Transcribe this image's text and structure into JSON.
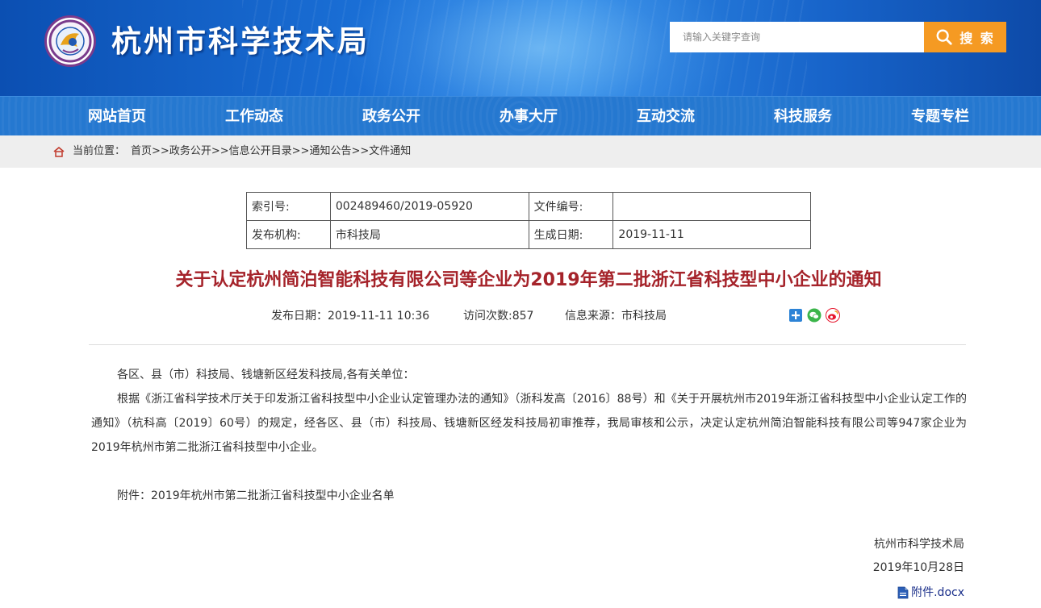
{
  "header": {
    "site_title": "杭州市科学技术局",
    "search_placeholder": "请输入关键字查询",
    "search_button": "搜 索"
  },
  "nav": {
    "items": [
      "网站首页",
      "工作动态",
      "政务公开",
      "办事大厅",
      "互动交流",
      "科技服务",
      "专题专栏"
    ]
  },
  "breadcrumb": {
    "prefix": "当前位置：",
    "links": [
      "首页",
      "政务公开",
      "信息公开目录",
      "通知公告",
      "文件通知"
    ],
    "separator": ">>"
  },
  "meta": {
    "index_label": "索引号:",
    "index_value": "002489460/2019-05920",
    "docno_label": "文件编号:",
    "docno_value": "",
    "org_label": "发布机构:",
    "org_value": "市科技局",
    "date_label": "生成日期:",
    "date_value": "2019-11-11"
  },
  "article": {
    "title": "关于认定杭州简泊智能科技有限公司等企业为2019年第二批浙江省科技型中小企业的通知",
    "publish_date": "发布日期：2019-11-11 10:36",
    "visits": "访问次数:857",
    "source": "信息来源：市科技局",
    "greeting": "各区、县（市）科技局、钱塘新区经发科技局,各有关单位：",
    "body": "根据《浙江省科学技术厅关于印发浙江省科技型中小企业认定管理办法的通知》（浙科发高〔2016〕88号）和《关于开展杭州市2019年浙江省科技型中小企业认定工作的通知》（杭科高〔2019〕60号）的规定，经各区、县（市）科技局、钱塘新区经发科技局初审推荐，我局审核和公示，决定认定杭州简泊智能科技有限公司等947家企业为2019年杭州市第二批浙江省科技型中小企业。",
    "attachment_note": "附件：2019年杭州市第二批浙江省科技型中小企业名单",
    "signer": "杭州市科学技术局",
    "sign_date": "2019年10月28日",
    "attachment_file": "附件.docx"
  },
  "colors": {
    "header_blue": "#1a6fd6",
    "nav_blue": "#2578d0",
    "search_orange": "#f59a23",
    "title_red": "#a5232a",
    "breadcrumb_bg": "#eeeeee"
  },
  "icons": [
    "logo-emblem",
    "search-icon",
    "home-icon",
    "share-plus-icon",
    "wechat-icon",
    "weibo-icon",
    "document-icon"
  ]
}
